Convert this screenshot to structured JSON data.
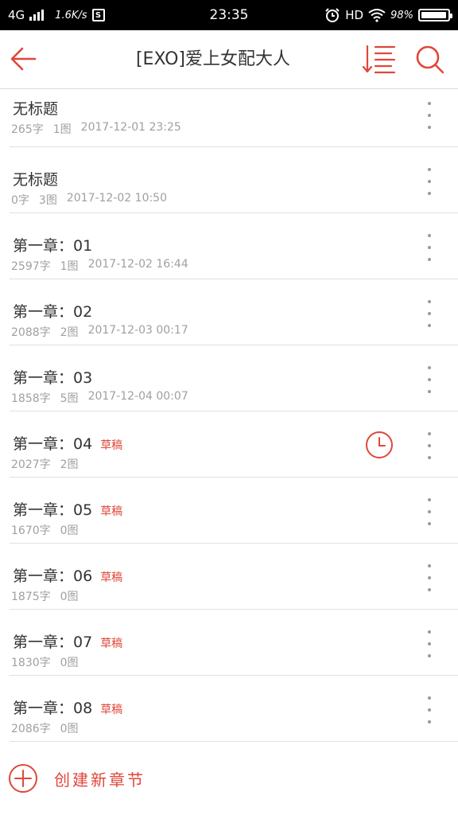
{
  "status_bar": {
    "network": "4G",
    "speed": "1.6K/s",
    "sim_badge": "S",
    "time": "23:35",
    "hd": "HD",
    "battery": "98%",
    "battery_level": 0.98,
    "icons": [
      "signal-icon",
      "alarm-icon",
      "wifi-icon",
      "battery-icon"
    ]
  },
  "header": {
    "title": "[EXO]爱上女配大人",
    "back_icon": "arrow-left-icon",
    "sort_icon": "sort-order-icon",
    "search_icon": "search-icon",
    "accent_color": "#e0473a"
  },
  "chapters": [
    {
      "title": "无标题",
      "draft": "",
      "words": "265字",
      "images": "1图",
      "datetime": "2017-12-01 23:25"
    },
    {
      "title": "无标题",
      "draft": "",
      "words": "0字",
      "images": "3图",
      "datetime": "2017-12-02 10:50"
    },
    {
      "title": "第一章：01",
      "draft": "",
      "words": "2597字",
      "images": "1图",
      "datetime": "2017-12-02 16:44"
    },
    {
      "title": "第一章：02",
      "draft": "",
      "words": "2088字",
      "images": "2图",
      "datetime": "2017-12-03 00:17"
    },
    {
      "title": "第一章：03",
      "draft": "",
      "words": "1858字",
      "images": "5图",
      "datetime": "2017-12-04 00:07"
    },
    {
      "title": "第一章：04",
      "draft": "草稿",
      "words": "2027字",
      "images": "2图",
      "datetime": "",
      "scheduled": true
    },
    {
      "title": "第一章：05",
      "draft": "草稿",
      "words": "1670字",
      "images": "0图",
      "datetime": ""
    },
    {
      "title": "第一章：06",
      "draft": "草稿",
      "words": "1875字",
      "images": "0图",
      "datetime": ""
    },
    {
      "title": "第一章：07",
      "draft": "草稿",
      "words": "1830字",
      "images": "0图",
      "datetime": ""
    },
    {
      "title": "第一章：08",
      "draft": "草稿",
      "words": "2086字",
      "images": "0图",
      "datetime": ""
    }
  ],
  "create": {
    "label": "创建新章节",
    "icon": "add-circle-icon"
  }
}
